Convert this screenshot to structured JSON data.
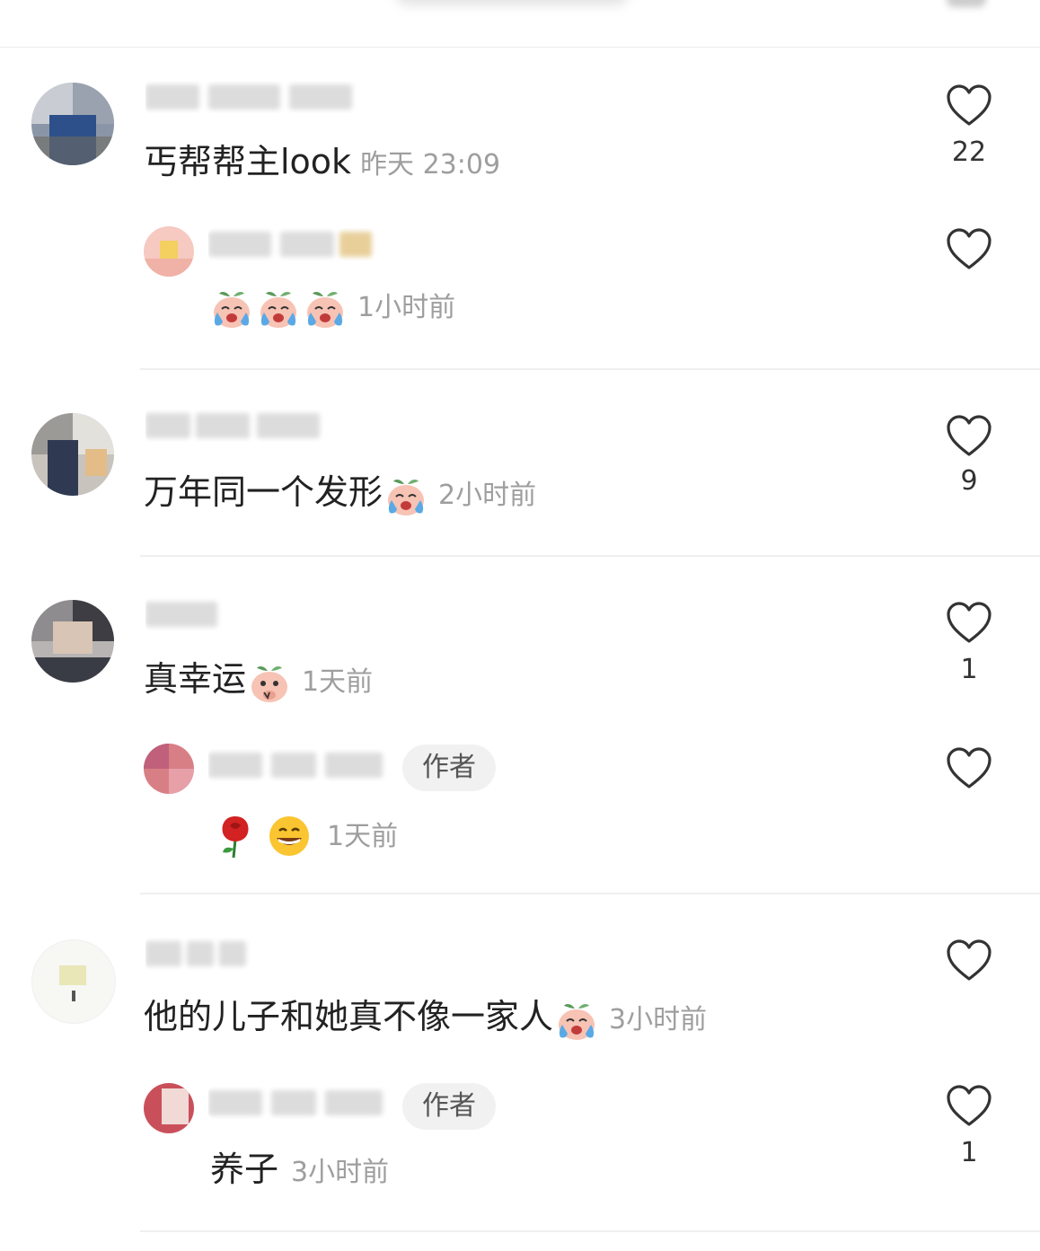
{
  "comments": [
    {
      "text": "丐帮帮主look",
      "time": "昨天 23:09",
      "likes": "22",
      "reply": {
        "time": "1小时前",
        "emoji": [
          "crying-peach-emoji",
          "crying-peach-emoji",
          "crying-peach-emoji"
        ]
      }
    },
    {
      "text": "万年同一个发形",
      "time": "2小时前",
      "likes": "9",
      "emoji": [
        "crying-peach-emoji"
      ]
    },
    {
      "text": "真幸运",
      "time": "1天前",
      "likes": "1",
      "emoji": [
        "shy-peach-emoji"
      ],
      "reply": {
        "badge": "作者",
        "time": "1天前",
        "emoji": [
          "rose-emoji",
          "grinning-face-emoji"
        ]
      }
    },
    {
      "text": "他的儿子和她真不像一家人",
      "time": "3小时前",
      "emoji": [
        "crying-peach-emoji"
      ],
      "reply": {
        "badge": "作者",
        "text": "养子",
        "time": "3小时前",
        "likes": "1"
      }
    }
  ],
  "colors": {
    "time": "#9e9e9e",
    "heart_stroke": "#333333",
    "divider": "#efefef",
    "badge_bg": "#f1f1f1"
  }
}
